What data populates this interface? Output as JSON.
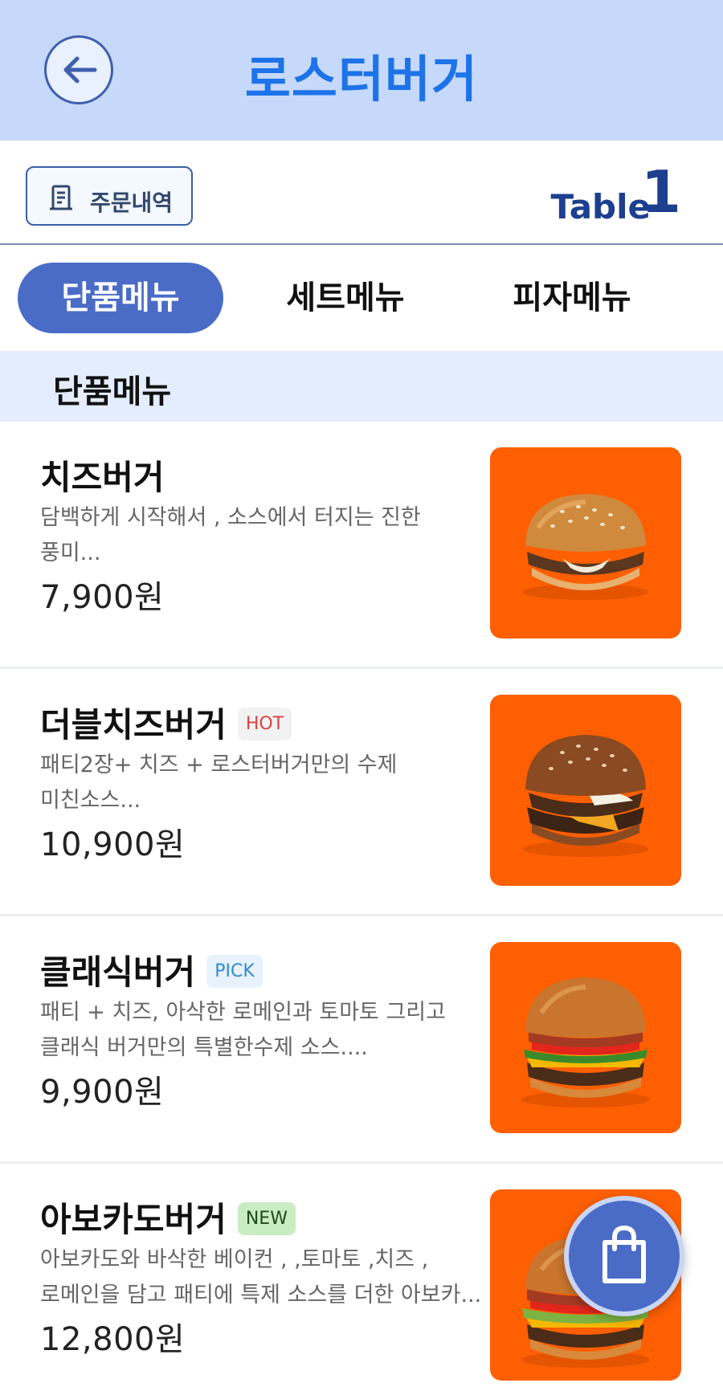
{
  "header": {
    "title": "로스터버거"
  },
  "info": {
    "orders_label": "주문내역",
    "table_label": "Table",
    "table_number": "1"
  },
  "tabs": [
    {
      "label": "단품메뉴",
      "active": true
    },
    {
      "label": "세트메뉴",
      "active": false
    },
    {
      "label": "피자메뉴",
      "active": false
    }
  ],
  "section": {
    "title": "단품메뉴"
  },
  "items": [
    {
      "name": "치즈버거",
      "badge": "",
      "desc": "담백하게 시작해서 , 소스에서 터지는 진한 풍미...",
      "price": "7,900원"
    },
    {
      "name": "더블치즈버거",
      "badge": "HOT",
      "desc": "패티2장+ 치즈 + 로스터버거만의 수제 미친소스...",
      "price": "10,900원"
    },
    {
      "name": "클래식버거",
      "badge": "PICK",
      "desc": "패티 + 치즈, 아삭한 로메인과 토마토 그리고 클래식 버거만의 특별한수제 소스....",
      "price": "9,900원"
    },
    {
      "name": "아보카도버거",
      "badge": "NEW",
      "desc": "아보카도와 바삭한 베이컨 , ,토마토 ,치즈 , 로메인을 담고 패티에 특제 소스를 더한 아보카...",
      "price": "12,800원"
    }
  ],
  "colors": {
    "header_bg": "#c6d9fb",
    "accent": "#4a6cc7",
    "title": "#1d73e8",
    "image_bg": "#fe5f02"
  },
  "icons": {
    "back": "arrow-left-icon",
    "orders": "receipt-icon",
    "cart": "shopping-bag-icon"
  }
}
